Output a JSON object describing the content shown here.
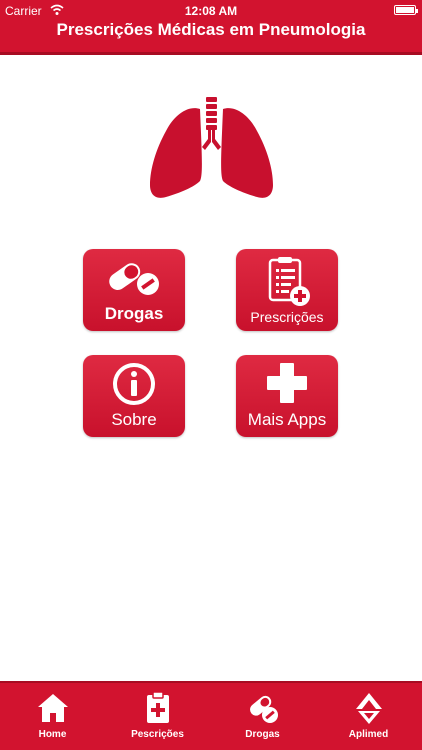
{
  "status_bar": {
    "carrier": "Carrier",
    "time": "12:08 AM"
  },
  "header": {
    "title": "Prescrições Médicas em Pneumologia"
  },
  "menu": {
    "drugs": "Drogas",
    "prescriptions": "Prescrições",
    "about": "Sobre",
    "more_apps": "Mais Apps"
  },
  "tabbar": {
    "home": "Home",
    "prescriptions": "Pescrições",
    "drugs": "Drogas",
    "aplimed": "Aplimed"
  },
  "colors": {
    "brand_red": "#d2132f",
    "dark_red": "#a70c22"
  }
}
